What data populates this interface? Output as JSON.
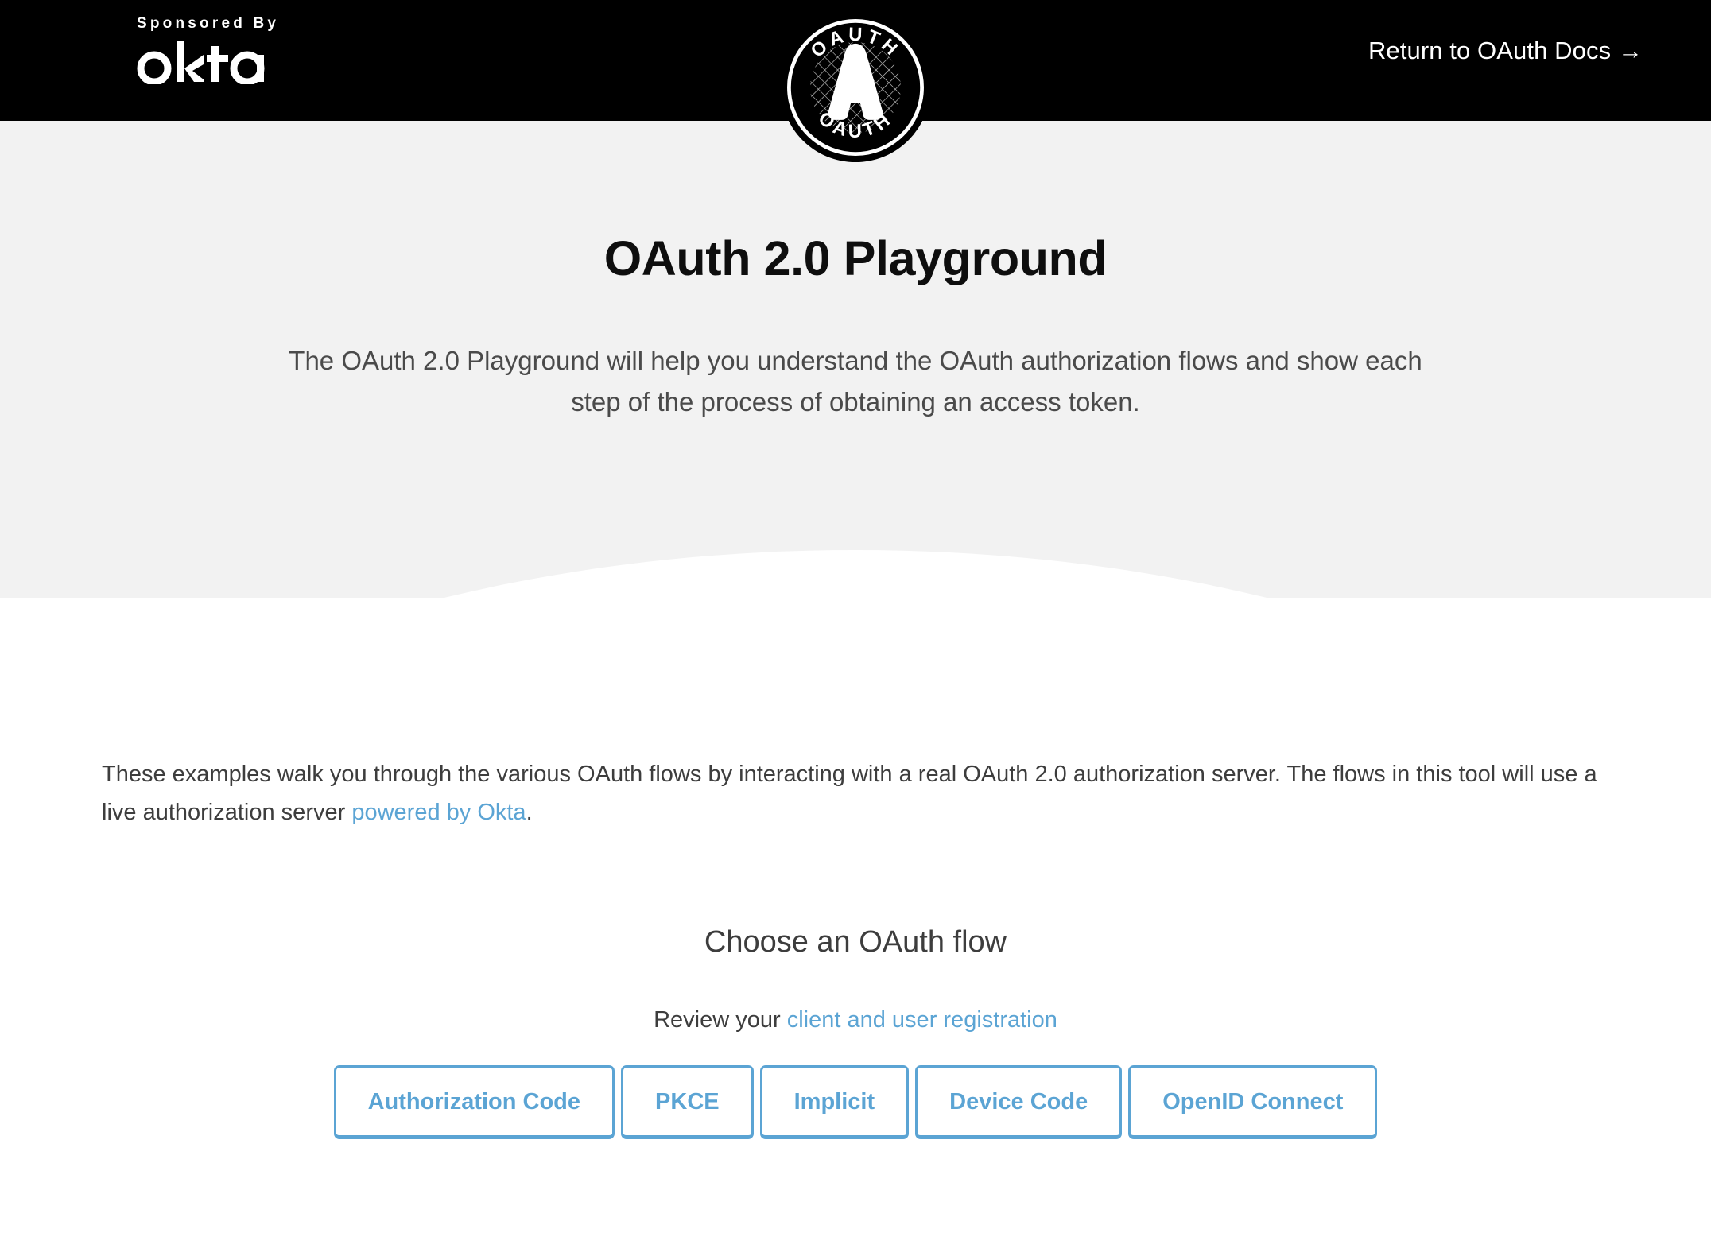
{
  "header": {
    "sponsor_label": "Sponsored By",
    "sponsor_brand": "okta",
    "logo_icon": "oauth-badge-icon",
    "logo_text_top": "OAUTH",
    "logo_text_bottom": "OAUTH",
    "logo_letter": "A",
    "docs_link": "Return to OAuth Docs →"
  },
  "hero": {
    "title": "OAuth 2.0 Playground",
    "subtitle": "The OAuth 2.0 Playground will help you understand the OAuth authorization flows and show each step of the process of obtaining an access token.",
    "background": "#f2f2f2"
  },
  "main": {
    "intro_part1": "These examples walk you through the various OAuth flows by interacting with a real OAuth 2.0 authorization server. The flows in this tool will use a live authorization server ",
    "intro_link": "powered by Okta",
    "intro_part2": ".",
    "choose_heading": "Choose an OAuth flow",
    "review_prefix": "Review your ",
    "review_link": "client and user registration",
    "flows": [
      {
        "label": "Authorization Code"
      },
      {
        "label": "PKCE"
      },
      {
        "label": "Implicit"
      },
      {
        "label": "Device Code"
      },
      {
        "label": "OpenID Connect"
      }
    ]
  },
  "colors": {
    "accent_blue": "#5ba4d4",
    "header_black": "#000000",
    "hero_grey": "#f2f2f2",
    "body_text": "#3d3d3d"
  }
}
